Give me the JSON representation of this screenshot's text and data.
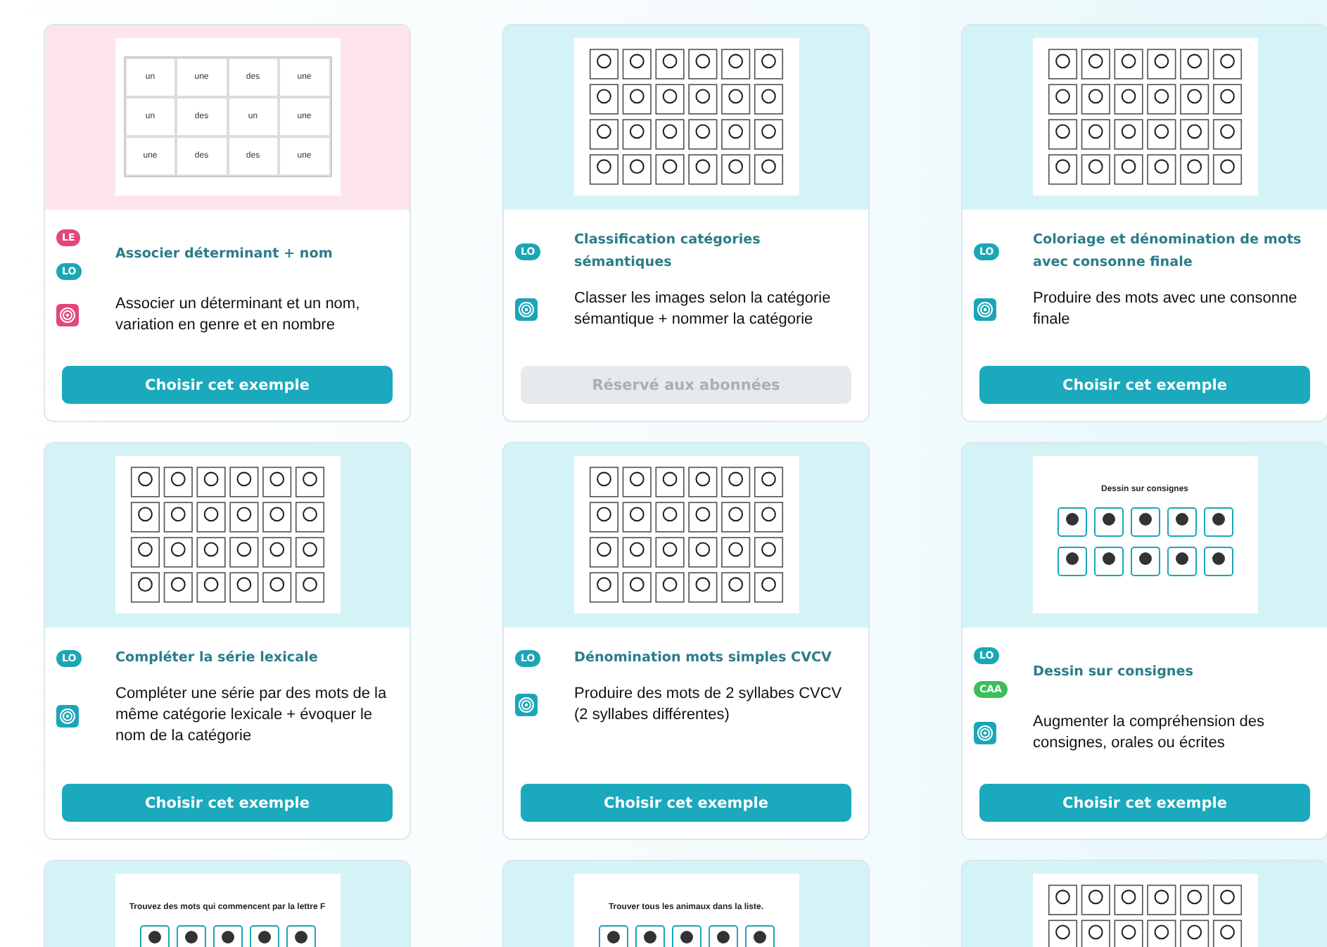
{
  "cards": [
    {
      "preview": {
        "kind": "word-grid",
        "color": "#fde4ec",
        "cells": [
          "un",
          "une",
          "des",
          "une",
          "un",
          "des",
          "un",
          "une",
          "une",
          "des",
          "des",
          "une"
        ]
      },
      "tags": [
        {
          "label": "LE",
          "color": "#e2467c"
        },
        {
          "label": "LO",
          "color": "#1aa6b7"
        }
      ],
      "title": "Associer déterminant + nom",
      "icon": {
        "color": "#e2467c"
      },
      "description": "Associer un déterminant et un nom, variation en genre et en nombre",
      "button": {
        "label": "Choisir cet exemple",
        "disabled": false
      }
    },
    {
      "preview": {
        "kind": "picture-grid",
        "color": "#d3f3f7"
      },
      "tags": [
        {
          "label": "LO",
          "color": "#1aa6b7"
        }
      ],
      "title": "Classification catégories sémantiques",
      "icon": {
        "color": "#1aa6b7"
      },
      "description": "Classer les images selon la catégorie sémantique + nommer la catégorie",
      "button": {
        "label": "Réservé aux abonnées",
        "disabled": true
      }
    },
    {
      "preview": {
        "kind": "picture-grid",
        "color": "#d3f3f7"
      },
      "tags": [
        {
          "label": "LO",
          "color": "#1aa6b7"
        }
      ],
      "title": "Coloriage et dénomination de mots avec consonne finale",
      "icon": {
        "color": "#1aa6b7"
      },
      "description": "Produire des mots avec une consonne finale",
      "button": {
        "label": "Choisir cet exemple",
        "disabled": false
      }
    },
    {
      "preview": {
        "kind": "picture-grid",
        "color": "#d3f3f7"
      },
      "tags": [
        {
          "label": "LO",
          "color": "#1aa6b7"
        }
      ],
      "title": "Compléter la série lexicale",
      "icon": {
        "color": "#1aa6b7"
      },
      "description": "Compléter une série par des mots de la même catégorie lexicale + évoquer le nom de la catégorie",
      "button": {
        "label": "Choisir cet exemple",
        "disabled": false
      }
    },
    {
      "preview": {
        "kind": "picture-grid",
        "color": "#d3f3f7"
      },
      "tags": [
        {
          "label": "LO",
          "color": "#1aa6b7"
        }
      ],
      "title": "Dénomination mots simples CVCV",
      "icon": {
        "color": "#1aa6b7"
      },
      "description": "Produire des mots de 2 syllabes CVCV (2 syllabes différentes)",
      "button": {
        "label": "Choisir cet exemple",
        "disabled": false
      }
    },
    {
      "preview": {
        "kind": "titled-sheet",
        "color": "#d3f3f7",
        "title": "Dessin sur consignes"
      },
      "tags": [
        {
          "label": "LO",
          "color": "#1aa6b7"
        },
        {
          "label": "CAA",
          "color": "#3cbf5a"
        }
      ],
      "title": "Dessin sur consignes",
      "icon": {
        "color": "#1aa6b7"
      },
      "description": "Augmenter la compréhension des consignes, orales ou écrites",
      "button": {
        "label": "Choisir cet exemple",
        "disabled": false
      }
    },
    {
      "preview": {
        "kind": "titled-sheet",
        "color": "#d3f3f7",
        "title": "Trouvez des mots qui commencent par la lettre F"
      }
    },
    {
      "preview": {
        "kind": "titled-sheet",
        "color": "#d3f3f7",
        "title": "Trouver tous les animaux dans la liste."
      }
    },
    {
      "preview": {
        "kind": "picture-grid",
        "color": "#d3f3f7"
      }
    }
  ]
}
